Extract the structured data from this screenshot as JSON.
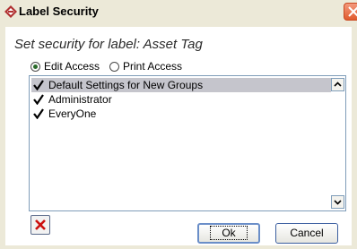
{
  "window": {
    "title": "Label Security"
  },
  "dialog": {
    "heading": "Set security for label:  Asset Tag"
  },
  "access": {
    "edit_label": "Edit Access",
    "print_label": "Print Access",
    "selected": "Edit Access"
  },
  "list": {
    "items": [
      {
        "label": "Default Settings for New Groups",
        "checked": true,
        "selected": true
      },
      {
        "label": "Administrator",
        "checked": true,
        "selected": false
      },
      {
        "label": "EveryOne",
        "checked": true,
        "selected": false
      }
    ]
  },
  "buttons": {
    "ok_label": "Ok",
    "cancel_label": "Cancel"
  },
  "colors": {
    "selection": "#c5c5cc",
    "close_button": "#e05a2d",
    "delete_icon": "#cc1111"
  }
}
